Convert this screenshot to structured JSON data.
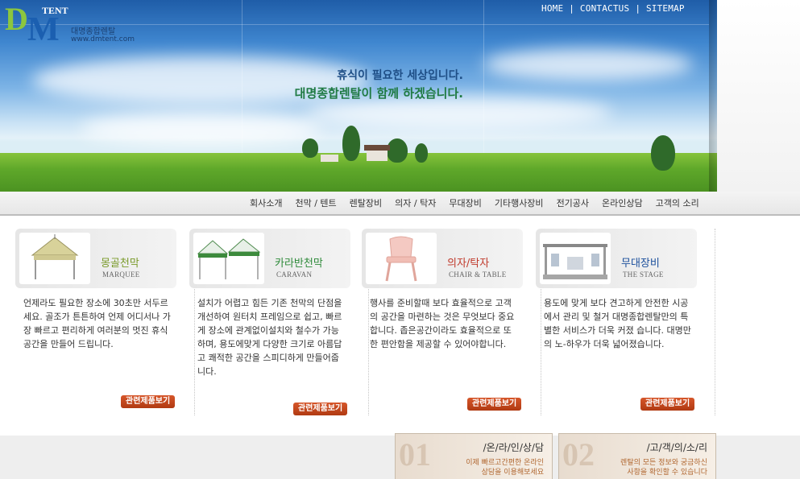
{
  "logo": {
    "letter_d": "D",
    "letter_m": "M",
    "tent": "TENT",
    "company": "대명종합렌탈",
    "url": "www.dmtent.com"
  },
  "topnav": {
    "home": "HOME",
    "contact": "CONTACTUS",
    "sitemap": "SITEMAP",
    "separator": "|"
  },
  "hero": {
    "line1": "휴식이 필요한 세상입니다.",
    "line2": "대명종합렌탈이 함께 하겠습니다."
  },
  "menu": [
    "회사소개",
    "천막 / 텐트",
    "렌탈장비",
    "의자 / 탁자",
    "무대장비",
    "기타행사장비",
    "전기공사",
    "온라인상담",
    "고객의 소리"
  ],
  "cards": [
    {
      "title_ko": "몽골천막",
      "title_en": "MARQUEE",
      "accent": "#7a9a2a",
      "desc": "언제라도 필요한 장소에 30초만 서두르세요. 골조가 튼튼하여 언제 어디서나 가장 빠르고 편리하게 여러분의 멋진 휴식공간을 만들어 드립니다.",
      "button": "관련제품보기"
    },
    {
      "title_ko": "카라반천막",
      "title_en": "CARAVAN",
      "accent": "#2e8a3a",
      "desc": "설치가 어렵고 힘든 기존 천막의 단점을 개선하여 원터치 프레임으로 쉽고, 빠르게 장소에 관계없이설치와 철수가 가능하며, 용도에맞게 다양한 크기로 아름답고 쾌적한 공간을 스피디하게 만들어줍니다.",
      "button": "관련제품보기"
    },
    {
      "title_ko": "의자/탁자",
      "title_en": "CHAIR & TABLE",
      "accent": "#c0392b",
      "desc": "행사를 준비할때 보다 효율적으로 고객의 공간을 마련하는 것은 무엇보다 중요합니다. 좁은공간이라도 효율적으로 또한 편안함을 제공할 수 있어야합니다.",
      "button": "관련제품보기"
    },
    {
      "title_ko": "무대장비",
      "title_en": "THE STAGE",
      "accent": "#1b4f9c",
      "desc": "용도에 맞게 보다 견고하게 안전한 시공에서 관리 및 철거 대명종합렌탈만의 특별한 서비스가 더욱 커졌 습니다. 대명만의 노-하우가 더욱 넓어졌습니다.",
      "button": "관련제품보기"
    }
  ],
  "footer_boxes": [
    {
      "num": "01",
      "title": "/온/라/인/상/담",
      "sub": "이제 빠르고간편한 온라인\n상담을 이용해보세요"
    },
    {
      "num": "02",
      "title": "/고/객/의/소/리",
      "sub": "렌탈의 모든 정보와 궁금하신\n사항을 확인할 수 있습니다"
    }
  ]
}
